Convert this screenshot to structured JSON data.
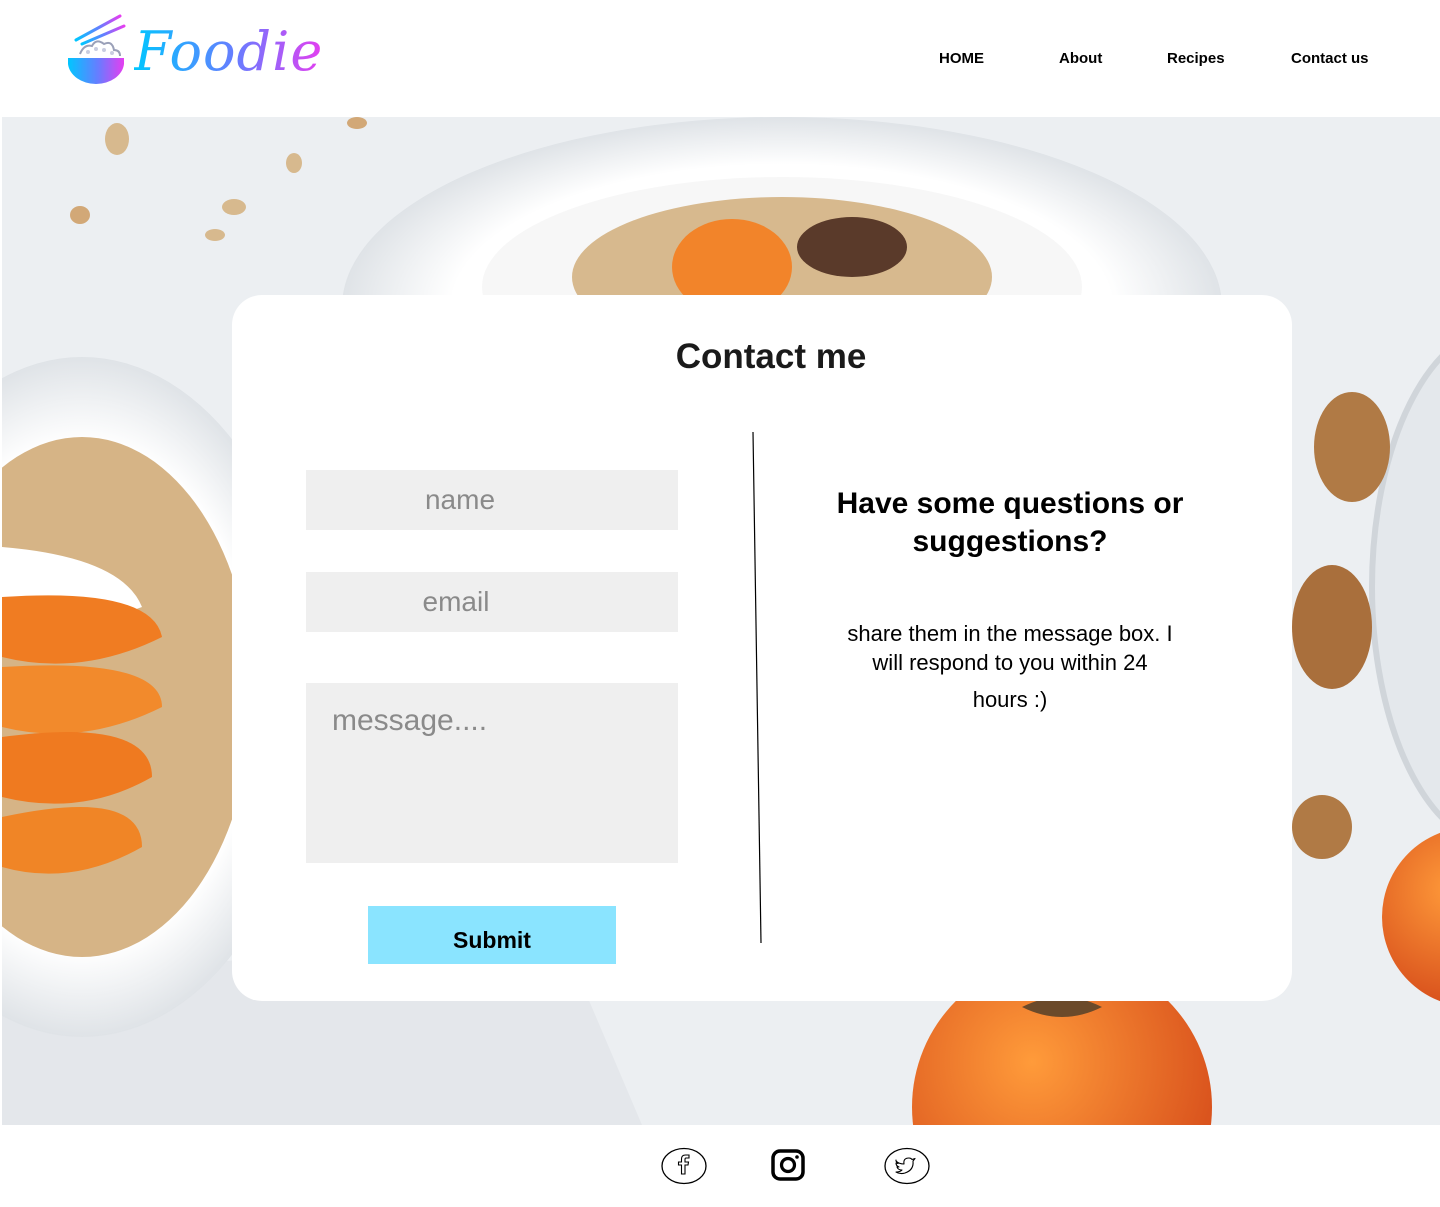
{
  "brand": {
    "name": "Foodie"
  },
  "nav": {
    "items": [
      {
        "label": "HOME"
      },
      {
        "label": "About"
      },
      {
        "label": "Recipes"
      },
      {
        "label": "Contact us"
      }
    ]
  },
  "contact": {
    "title": "Contact me",
    "name_placeholder": "name",
    "email_placeholder": "email",
    "message_placeholder": "message....",
    "submit_label": "Submit",
    "heading": "Have some questions or suggestions?",
    "text_line1": "share them in the message box. I will respond to you within 24",
    "text_line2": "hours :)"
  },
  "footer": {
    "icons": [
      "facebook-icon",
      "instagram-icon",
      "twitter-icon"
    ]
  },
  "colors": {
    "accent": "#8ae4ff",
    "field_bg": "#efefef",
    "logo_gradient": [
      "#00c6ff",
      "#e53ef0"
    ]
  }
}
